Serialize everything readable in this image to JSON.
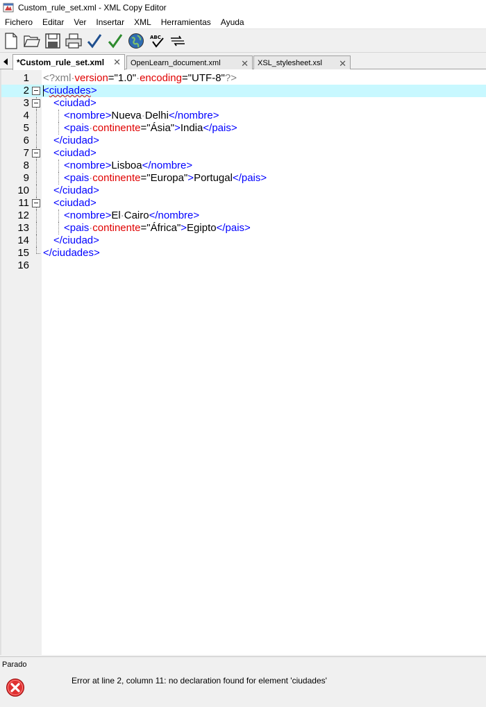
{
  "window": {
    "title": "Custom_rule_set.xml - XML Copy Editor"
  },
  "menu": [
    "Fichero",
    "Editar",
    "Ver",
    "Insertar",
    "XML",
    "Herramientas",
    "Ayuda"
  ],
  "toolbar": {
    "buttons": [
      "new-document-icon",
      "open-folder-icon",
      "save-icon",
      "print-icon",
      "check-wellformed-icon",
      "validate-icon",
      "browser-icon",
      "spellcheck-icon",
      "xslt-icon"
    ]
  },
  "tabs": [
    {
      "label": "*Custom_rule_set.xml",
      "active": true
    },
    {
      "label": "OpenLearn_document.xml",
      "active": false
    },
    {
      "label": "XSL_stylesheet.xsl",
      "active": false
    }
  ],
  "editor": {
    "current_line": 2,
    "line_numbers": [
      "1",
      "2",
      "3",
      "4",
      "5",
      "6",
      "7",
      "8",
      "9",
      "10",
      "11",
      "12",
      "13",
      "14",
      "15",
      "16"
    ],
    "lines": [
      {
        "n": "1",
        "indent": "",
        "parts": [
          [
            "pi",
            "<?xml"
          ],
          [
            "ws",
            "·"
          ],
          [
            "attr",
            "version"
          ],
          [
            "val",
            "=\"1.0\""
          ],
          [
            "ws",
            "·"
          ],
          [
            "attr",
            "encoding"
          ],
          [
            "val",
            "=\"UTF-8\""
          ],
          [
            "pi",
            "?>"
          ]
        ]
      },
      {
        "n": "2",
        "indent": "",
        "parts": [
          [
            "tag",
            "<"
          ],
          [
            "tag squig",
            "ciudades"
          ],
          [
            "tag",
            ">"
          ]
        ]
      },
      {
        "n": "3",
        "indent": "  ",
        "parts": [
          [
            "tag",
            "<ciudad>"
          ]
        ]
      },
      {
        "n": "4",
        "indent": "    ",
        "parts": [
          [
            "tag",
            "<nombre>"
          ],
          [
            "txt",
            "Nueva"
          ],
          [
            "ws",
            "·"
          ],
          [
            "txt",
            "Delhi"
          ],
          [
            "tag",
            "</nombre>"
          ]
        ]
      },
      {
        "n": "5",
        "indent": "    ",
        "parts": [
          [
            "tag",
            "<pais"
          ],
          [
            "ws",
            "·"
          ],
          [
            "attr",
            "continente"
          ],
          [
            "val",
            "=\"Ásia\""
          ],
          [
            "tag",
            ">"
          ],
          [
            "txt",
            "India"
          ],
          [
            "tag",
            "</pais>"
          ]
        ]
      },
      {
        "n": "6",
        "indent": "  ",
        "parts": [
          [
            "tag",
            "</ciudad>"
          ]
        ]
      },
      {
        "n": "7",
        "indent": "  ",
        "parts": [
          [
            "tag",
            "<ciudad>"
          ]
        ]
      },
      {
        "n": "8",
        "indent": "    ",
        "parts": [
          [
            "tag",
            "<nombre>"
          ],
          [
            "txt",
            "Lisboa"
          ],
          [
            "tag",
            "</nombre>"
          ]
        ]
      },
      {
        "n": "9",
        "indent": "    ",
        "parts": [
          [
            "tag",
            "<pais"
          ],
          [
            "ws",
            "·"
          ],
          [
            "attr",
            "continente"
          ],
          [
            "val",
            "=\"Europa\""
          ],
          [
            "tag",
            ">"
          ],
          [
            "txt",
            "Portugal"
          ],
          [
            "tag",
            "</pais>"
          ]
        ]
      },
      {
        "n": "10",
        "indent": "  ",
        "parts": [
          [
            "tag",
            "</ciudad>"
          ]
        ]
      },
      {
        "n": "11",
        "indent": "  ",
        "parts": [
          [
            "tag",
            "<ciudad>"
          ]
        ]
      },
      {
        "n": "12",
        "indent": "    ",
        "parts": [
          [
            "tag",
            "<nombre>"
          ],
          [
            "txt",
            "El"
          ],
          [
            "ws",
            "·"
          ],
          [
            "txt",
            "Cairo"
          ],
          [
            "tag",
            "</nombre>"
          ]
        ]
      },
      {
        "n": "13",
        "indent": "    ",
        "parts": [
          [
            "tag",
            "<pais"
          ],
          [
            "ws",
            "·"
          ],
          [
            "attr",
            "continente"
          ],
          [
            "val",
            "=\"África\""
          ],
          [
            "tag",
            ">"
          ],
          [
            "txt",
            "Egipto"
          ],
          [
            "tag",
            "</pais>"
          ]
        ]
      },
      {
        "n": "14",
        "indent": "  ",
        "parts": [
          [
            "tag",
            "</ciudad>"
          ]
        ]
      },
      {
        "n": "15",
        "indent": "",
        "parts": [
          [
            "tag",
            "</ciudades>"
          ]
        ]
      },
      {
        "n": "16",
        "indent": "",
        "parts": []
      }
    ]
  },
  "status": {
    "text": "Parado"
  },
  "error": {
    "icon": "error-icon",
    "message": "Error at line 2, column 11: no declaration found for element 'ciudades'"
  }
}
